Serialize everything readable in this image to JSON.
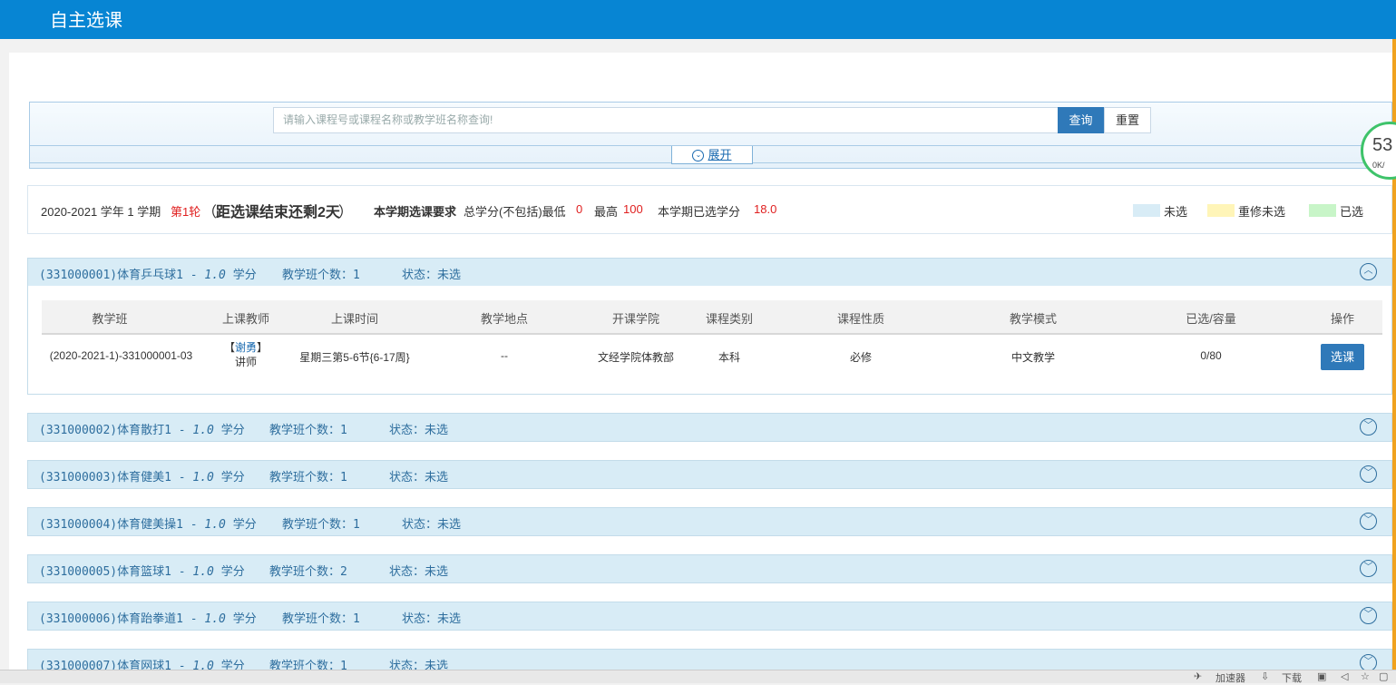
{
  "header": {
    "title": "自主选课"
  },
  "search": {
    "placeholder": "请输入课程号或课程名称或教学班名称查询!",
    "query_label": "查询",
    "reset_label": "重置",
    "expand_label": "展开"
  },
  "speed_widget": {
    "value": "53",
    "unit": "0K/"
  },
  "info": {
    "year": "2020-2021 学年 1 学期",
    "round": "第1轮",
    "countdown_open": "（",
    "countdown": "距选课结束还剩2天",
    "countdown_close": "）",
    "req_label": "本学期选课要求",
    "req_text": "总学分(不包括)最低",
    "min": "0",
    "max_label": "最高",
    "max": "100",
    "selected_label": "本学期已选学分",
    "selected": "18.0"
  },
  "legend": [
    {
      "label": "未选",
      "color": "#d8ecf6"
    },
    {
      "label": "重修未选",
      "color": "#fff5b8"
    },
    {
      "label": "已选",
      "color": "#c8f5c8"
    }
  ],
  "table": {
    "headers": [
      "教学班",
      "上课教师",
      "上课时间",
      "教学地点",
      "开课学院",
      "课程类别",
      "课程性质",
      "教学模式",
      "已选/容量",
      "操作"
    ],
    "row": {
      "class": "(2020-2021-1)-331000001-03",
      "teacher_name": "谢勇",
      "teacher_title": "讲师",
      "time": "星期三第5-6节{6-17周}",
      "place": "--",
      "college": "文经学院体教部",
      "category": "本科",
      "nature": "必修",
      "mode": "中文教学",
      "capacity": "0/80",
      "action": "选课"
    }
  },
  "courses": [
    {
      "code": "(331000001)体育乒乓球1",
      "credit": "1.0",
      "credit_unit": "学分",
      "class_count": "教学班个数：1",
      "status": "状态：未选",
      "expanded": true
    },
    {
      "code": "(331000002)体育散打1",
      "credit": "1.0",
      "credit_unit": "学分",
      "class_count": "教学班个数：1",
      "status": "状态：未选",
      "expanded": false
    },
    {
      "code": "(331000003)体育健美1",
      "credit": "1.0",
      "credit_unit": "学分",
      "class_count": "教学班个数：1",
      "status": "状态：未选",
      "expanded": false
    },
    {
      "code": "(331000004)体育健美操1",
      "credit": "1.0",
      "credit_unit": "学分",
      "class_count": "教学班个数：1",
      "status": "状态：未选",
      "expanded": false
    },
    {
      "code": "(331000005)体育篮球1",
      "credit": "1.0",
      "credit_unit": "学分",
      "class_count": "教学班个数：2",
      "status": "状态：未选",
      "expanded": false
    },
    {
      "code": "(331000006)体育跆拳道1",
      "credit": "1.0",
      "credit_unit": "学分",
      "class_count": "教学班个数：1",
      "status": "状态：未选",
      "expanded": false
    },
    {
      "code": "(331000007)体育网球1",
      "credit": "1.0",
      "credit_unit": "学分",
      "class_count": "教学班个数：1",
      "status": "状态：未选",
      "expanded": false
    }
  ],
  "statusbar": {
    "accelerator": "加速器",
    "download": "下载"
  }
}
